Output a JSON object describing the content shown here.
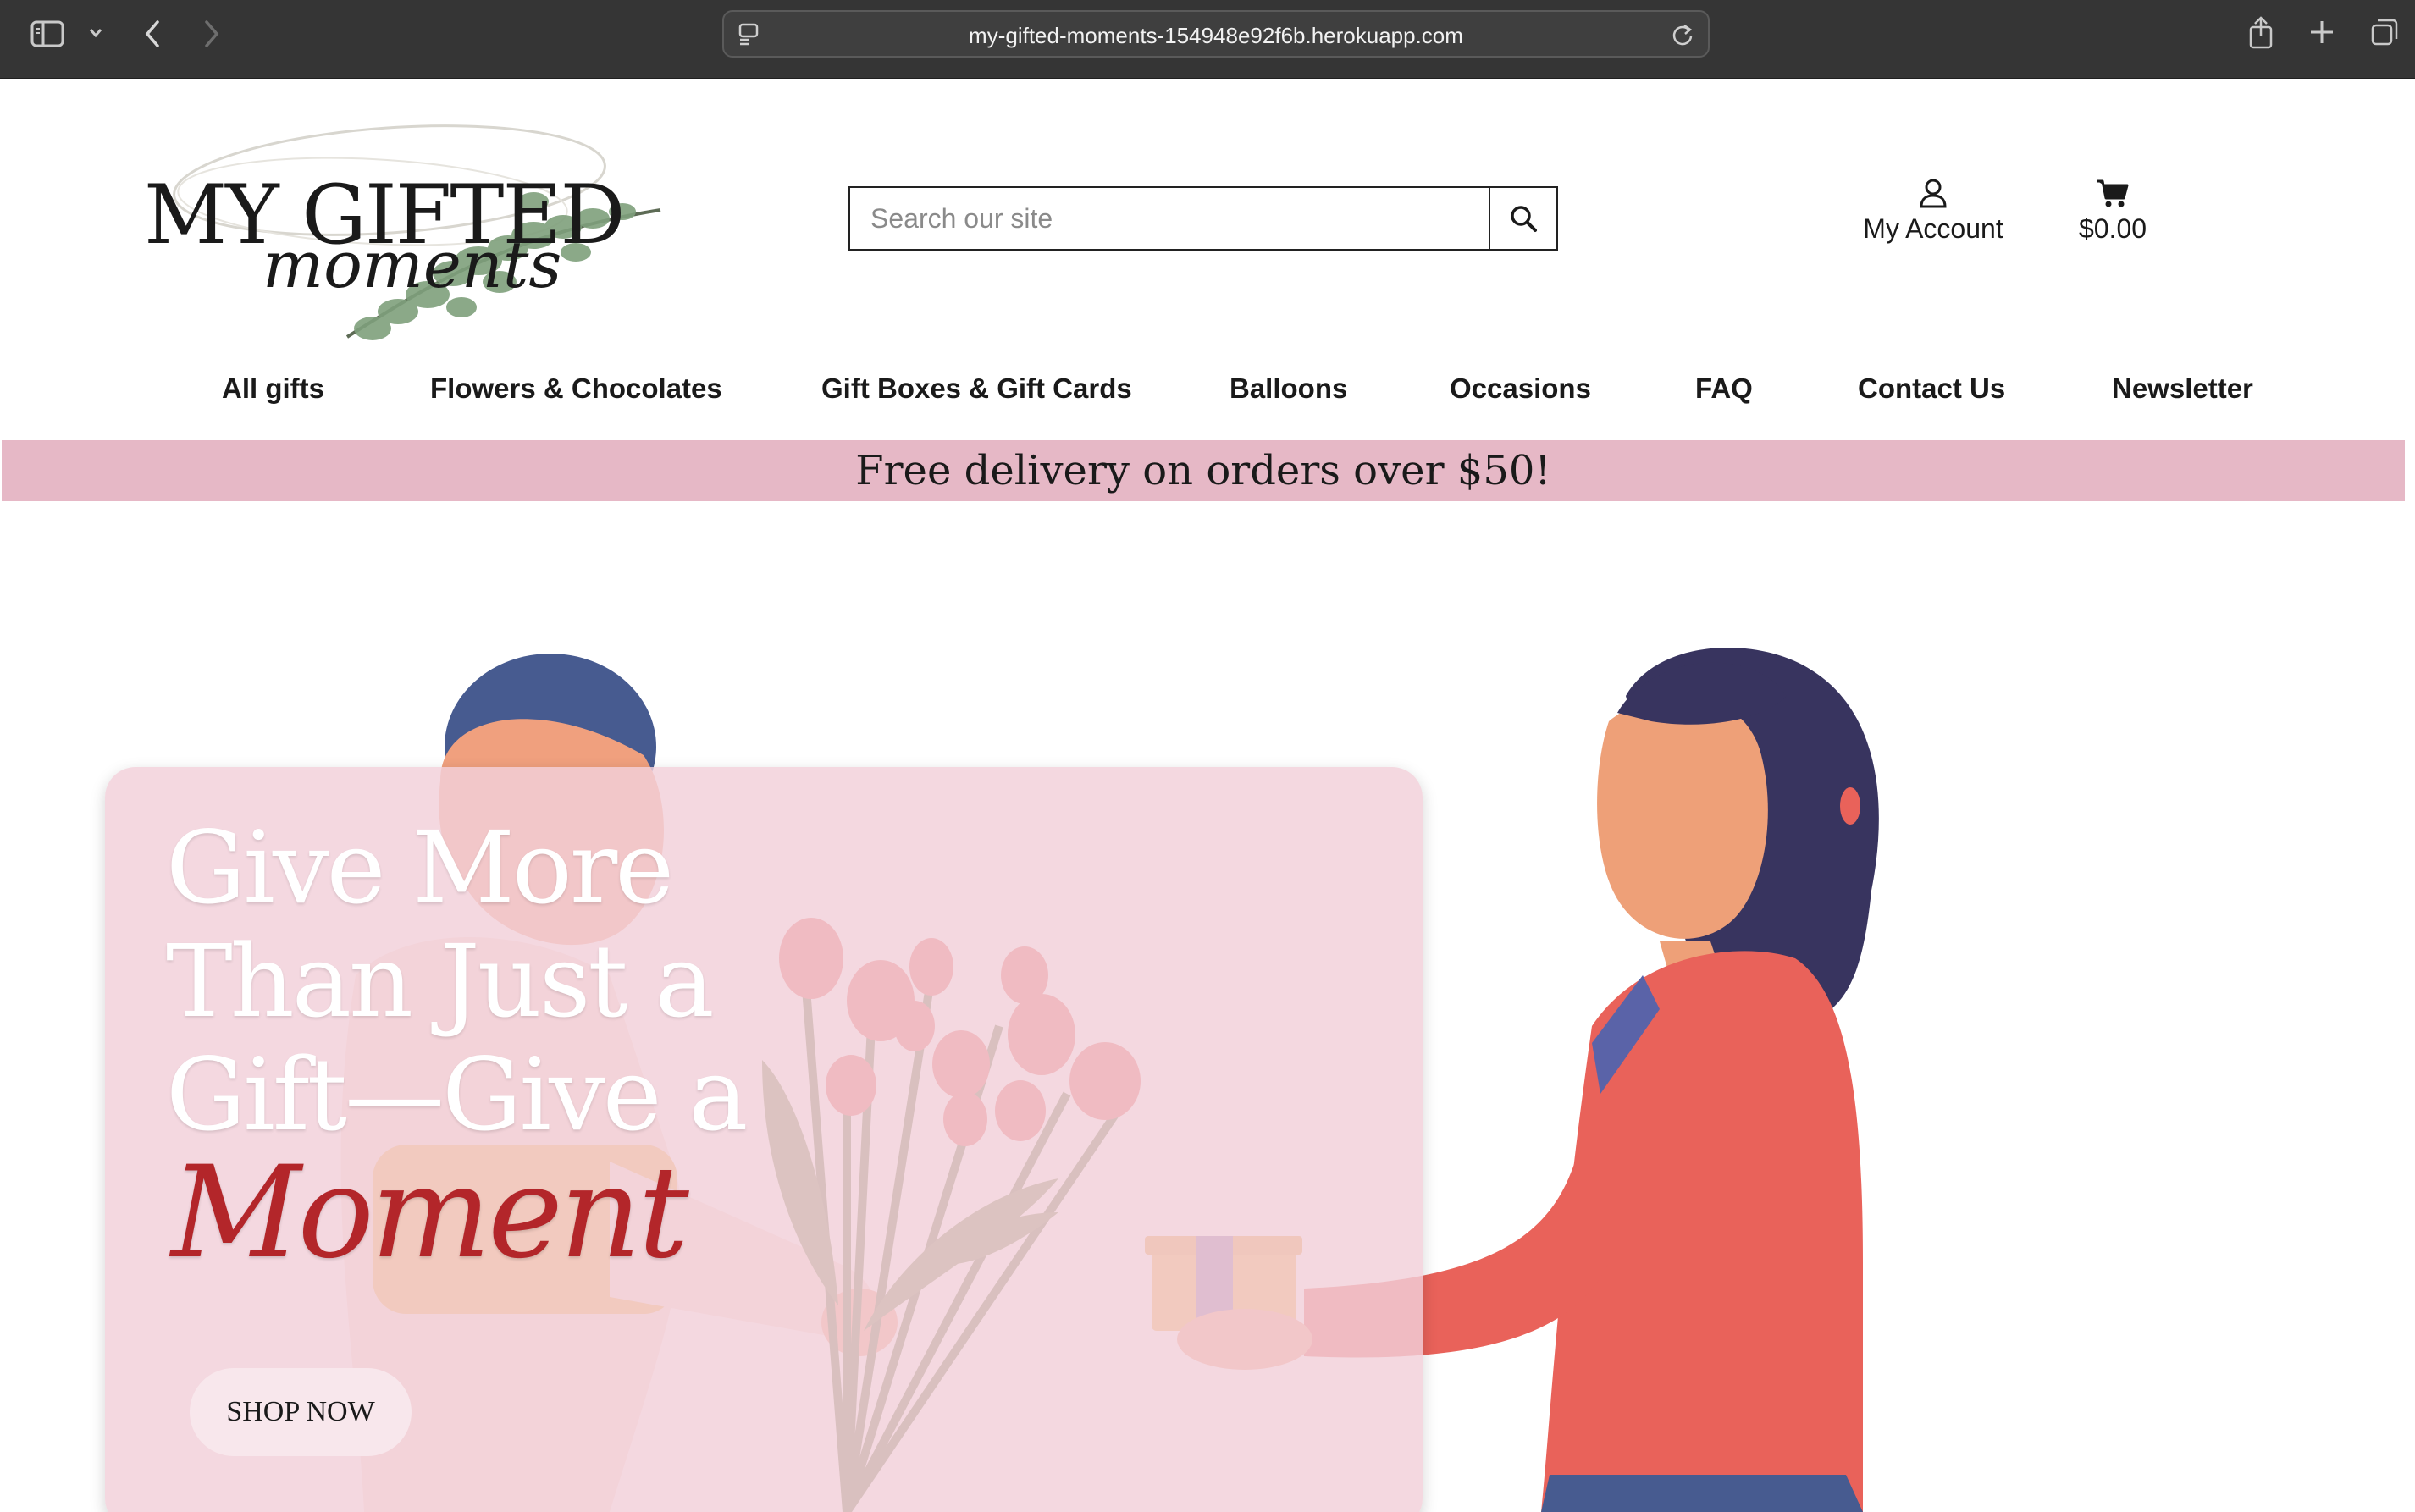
{
  "browser": {
    "url": "my-gifted-moments-154948e92f6b.herokuapp.com",
    "icons": [
      "sidebar-icon",
      "chevron-down-icon",
      "back-icon",
      "forward-icon",
      "site-settings-icon",
      "reload-icon",
      "share-icon",
      "new-tab-icon",
      "tabs-icon"
    ]
  },
  "header": {
    "logo": {
      "line1": "MY GIFTED",
      "line2": "moments"
    },
    "search": {
      "placeholder": "Search our site",
      "value": ""
    },
    "account_label": "My Account",
    "cart_total": "$0.00"
  },
  "nav": {
    "items": [
      "All gifts",
      "Flowers & Chocolates",
      "Gift Boxes & Gift Cards",
      "Balloons",
      "Occasions",
      "FAQ",
      "Contact Us",
      "Newsletter"
    ]
  },
  "banner": {
    "text": "Free delivery on orders over $50!"
  },
  "hero": {
    "headline": [
      "Give More",
      "Than Just a",
      "Gift—Give a"
    ],
    "highlight": "Moment",
    "cta": "SHOP NOW"
  },
  "colors": {
    "chrome": "#353535",
    "banner": "#e6b8c6",
    "card": "#f2d0d9",
    "accent_red": "#b3262a",
    "jacket": "#e9625a",
    "hair": "#38345f"
  }
}
